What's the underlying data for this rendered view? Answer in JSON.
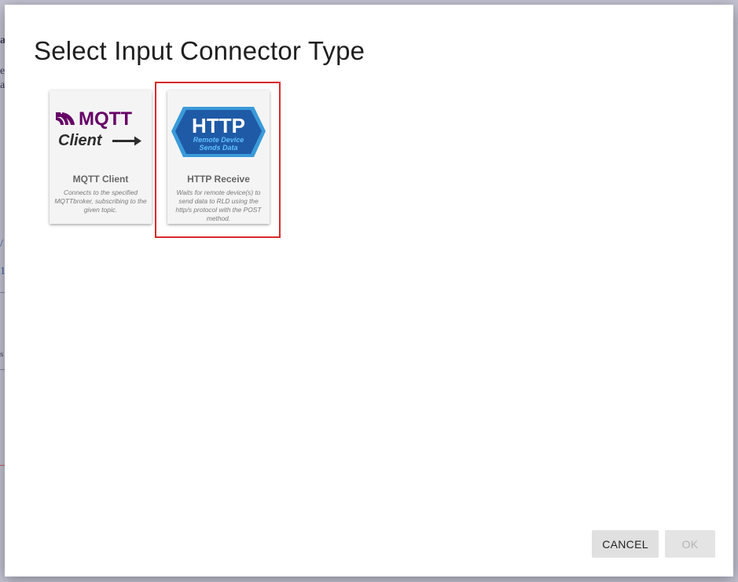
{
  "dialog": {
    "title": "Select Input Connector Type"
  },
  "connectors": [
    {
      "logo_line1": "MQTT",
      "logo_line2": "Client",
      "name": "MQTT Client",
      "description": "Connects to the specified MQTTbroker, subscribing to the given topic.",
      "selected": false
    },
    {
      "logo_line1": "HTTP",
      "logo_line2": "Remote Device",
      "logo_line3": "Sends Data",
      "name": "HTTP Receive",
      "description": "Waits for remote device(s) to send data to RLD using the http/s protocol with the POST method.",
      "selected": true
    }
  ],
  "buttons": {
    "cancel": "CANCEL",
    "ok": "OK"
  },
  "colors": {
    "mqtt_brand": "#660066",
    "http_brand_dark": "#1f5aa6",
    "http_brand_light": "#3a9ad9",
    "selection_outline": "#d82a2a"
  },
  "background_fragments": [
    "a",
    "e",
    "a",
    "/",
    "1",
    "s"
  ]
}
